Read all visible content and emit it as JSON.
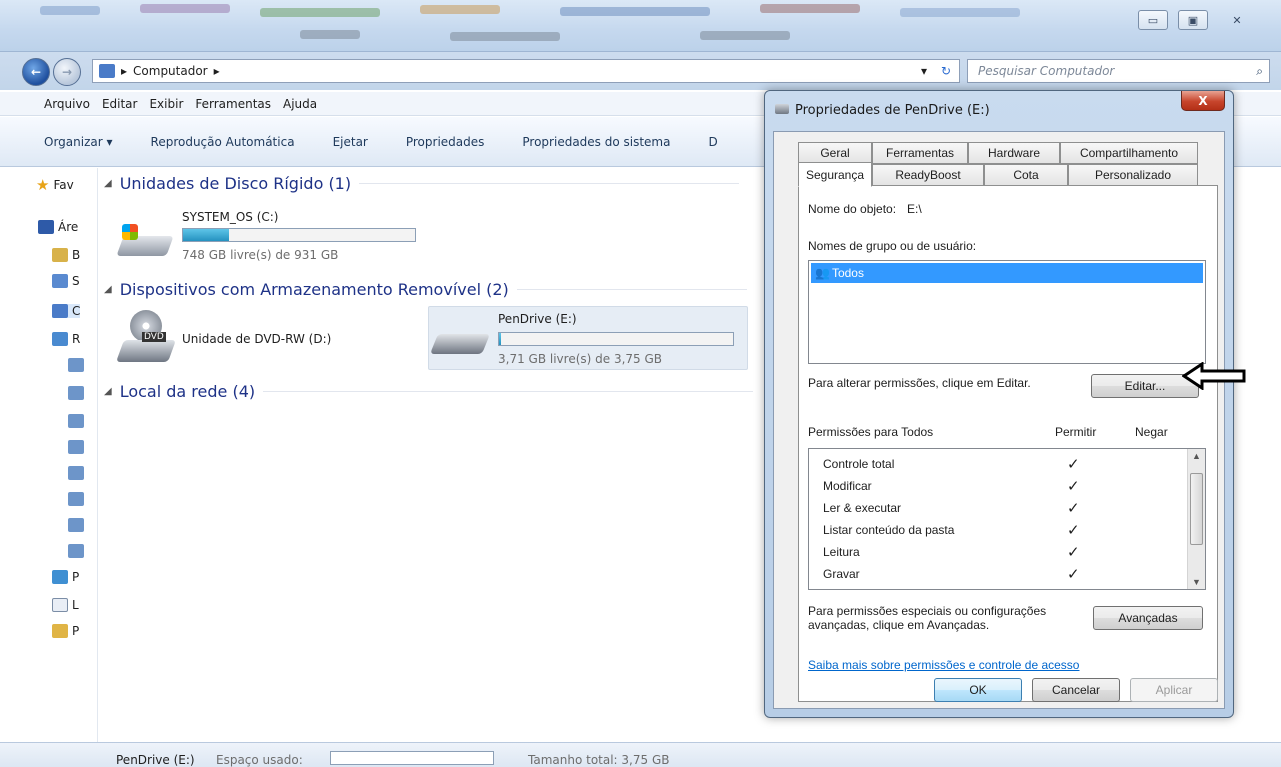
{
  "explorer": {
    "address": {
      "location": "Computador",
      "search_placeholder": "Pesquisar Computador"
    },
    "menu": [
      "Arquivo",
      "Editar",
      "Exibir",
      "Ferramentas",
      "Ajuda"
    ],
    "commands": [
      "Organizar ▾",
      "Reprodução Automática",
      "Ejetar",
      "Propriedades",
      "Propriedades do sistema",
      "D"
    ],
    "nav": [
      "Fav",
      "Áre",
      "B",
      "S",
      "C",
      "R",
      "P",
      "L",
      "P"
    ],
    "groups": {
      "hdd": {
        "title": "Unidades de Disco Rígido (1)",
        "drive": {
          "name": "SYSTEM_OS (C:)",
          "space": "748 GB livre(s) de 931 GB",
          "used_fraction": 0.2
        }
      },
      "removable": {
        "title": "Dispositivos com Armazenamento Removível (2)",
        "dvd": {
          "name": "Unidade de DVD-RW (D:)",
          "icon_text": "DVD"
        },
        "pendrive": {
          "name": "PenDrive (E:)",
          "space": "3,71 GB livre(s) de 3,75 GB",
          "used_fraction": 0.01
        }
      },
      "network": {
        "title": "Local da rede (4)"
      }
    },
    "status": {
      "name": "PenDrive (E:)",
      "used_label": "Espaço usado:",
      "total": "Tamanho total: 3,75 GB"
    }
  },
  "dialog": {
    "title": "Propriedades de PenDrive (E:)",
    "close": "X",
    "tabs_row1": [
      "Geral",
      "Ferramentas",
      "Hardware",
      "Compartilhamento"
    ],
    "tabs_row2": [
      "Segurança",
      "ReadyBoost",
      "Cota",
      "Personalizado"
    ],
    "object_name_label": "Nome do objeto:",
    "object_name_value": "E:\\",
    "groups_label": "Nomes de grupo ou de usuário:",
    "groups": [
      "Todos"
    ],
    "change_hint": "Para alterar permissões, clique em Editar.",
    "edit_button": "Editar...",
    "permissions_label": "Permissões para Todos",
    "allow_header": "Permitir",
    "deny_header": "Negar",
    "permissions": [
      {
        "name": "Controle total",
        "allow": "✓",
        "deny": ""
      },
      {
        "name": "Modificar",
        "allow": "✓",
        "deny": ""
      },
      {
        "name": "Ler & executar",
        "allow": "✓",
        "deny": ""
      },
      {
        "name": "Listar conteúdo da pasta",
        "allow": "✓",
        "deny": ""
      },
      {
        "name": "Leitura",
        "allow": "✓",
        "deny": ""
      },
      {
        "name": "Gravar",
        "allow": "✓",
        "deny": ""
      }
    ],
    "special_hint_1": "Para permissões especiais ou configurações",
    "special_hint_2": "avançadas, clique em Avançadas.",
    "advanced_button": "Avançadas",
    "learn_more": "Saiba mais sobre permissões e controle de acesso",
    "ok": "OK",
    "cancel": "Cancelar",
    "apply": "Aplicar"
  }
}
